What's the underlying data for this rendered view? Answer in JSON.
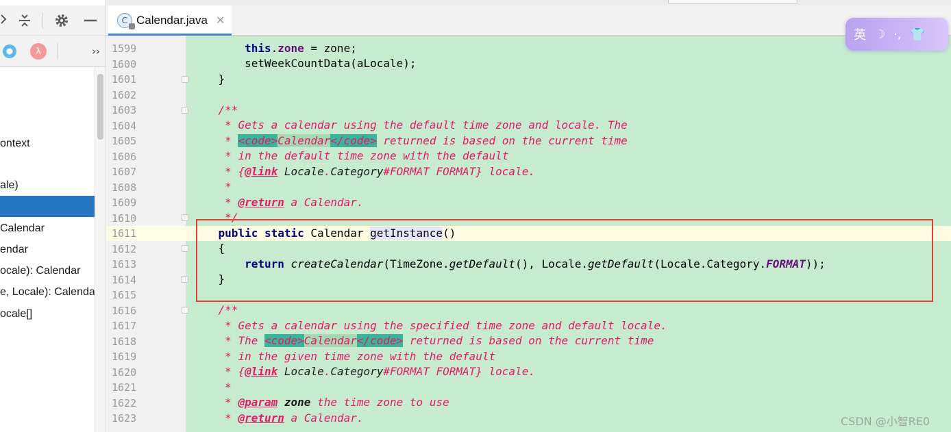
{
  "window": {
    "editor_tab": {
      "label": "Calendar.java",
      "icon": "java-class-icon",
      "close": "✕"
    }
  },
  "structure_toolbar": {
    "icons": [
      "collapse-icon",
      "gear-icon",
      "minimize-icon",
      "circle-filter-icon",
      "lambda-filter-icon",
      "more-icon"
    ],
    "lambda_glyph": "λ",
    "more_glyph": "››"
  },
  "structure_items": [
    {
      "label": "ontext",
      "selected": false
    },
    {
      "label": "ale)",
      "selected": false
    },
    {
      "label": "",
      "selected": true
    },
    {
      "label": "Calendar",
      "selected": false
    },
    {
      "label": "endar",
      "selected": false
    },
    {
      "label": "ocale): Calendar",
      "selected": false
    },
    {
      "label": "e, Locale): Calendar",
      "selected": false
    },
    {
      "label": "ocale[]",
      "selected": false
    }
  ],
  "editor": {
    "line_numbers": [
      "1599",
      "1600",
      "1601",
      "1602",
      "1603",
      "1604",
      "1605",
      "1606",
      "1607",
      "1608",
      "1609",
      "1610",
      "1611",
      "1612",
      "1613",
      "1614",
      "1615",
      "1616",
      "1617",
      "1618",
      "1619",
      "1620",
      "1621",
      "1622",
      "1623"
    ],
    "current_line": "1611",
    "tokens": {
      "this": "this",
      "dot": ".",
      "zone_field": "zone",
      "assign_zone": " = zone;",
      "set_week": "setWeekCountData(aLocale);",
      "close_brace": "}",
      "open_brace": "{",
      "doc_open": "/**",
      "doc_star": "*",
      "doc_close": "*/",
      "l1604": "Gets a calendar using the default time zone and locale. The",
      "code_open": "<code>",
      "code_word": "Calendar",
      "code_close": "</code>",
      "l1605_tail": " returned is based on the current time",
      "l1606": "in the default time zone with the default",
      "link_open": "{",
      "link_tag": "@link",
      "locale_ref": " Locale",
      "category_ref": "Category",
      "format_ref": "#FORMAT FORMAT} locale.",
      "return_tag": "@return",
      "a_calendar": " a Calendar.",
      "public": "public",
      "static": "static",
      "calendar_type": " Calendar ",
      "get_instance": "getInstance",
      "parens": "()",
      "return_kw": "return",
      "create_calendar": "createCalendar",
      "timezone_call": "(TimeZone.",
      "get_default": "getDefault",
      "comma_locale": "(), Locale.",
      "locale_category": "(Locale.Category.",
      "format_const": "FORMAT",
      "end_call": "));",
      "l1617": "Gets a calendar using the specified time zone and default locale.",
      "the": "The ",
      "l1619": "in the given time zone with the default",
      "param_tag": "@param",
      "zone_word": "zone",
      "use_tail": " the time zone to use"
    }
  },
  "overlays": {
    "ime_labels": [
      "英",
      "☽",
      "·,",
      "👕"
    ],
    "watermark": "CSDN @小智RE0"
  },
  "colors": {
    "code_background": "#c7ebcf",
    "selection": "#2675bf",
    "annotation_border": "#e23b3b",
    "keyword": "#000080",
    "doc_comment": "#e51a67"
  }
}
